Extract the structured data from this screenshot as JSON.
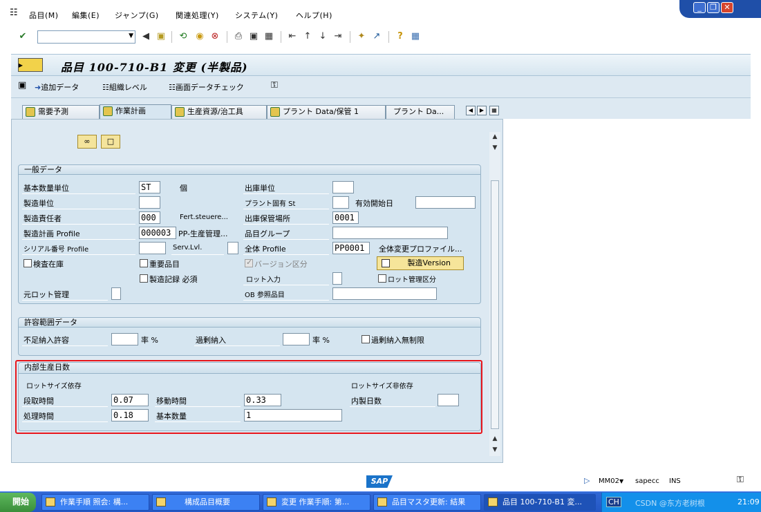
{
  "menu": [
    "品目(M)",
    "編集(E)",
    "ジャンプ(G)",
    "関連処理(Y)",
    "システム(Y)",
    "ヘルプ(H)"
  ],
  "title": "品目 100-710-B1 変更 (半製品)",
  "app_toolbar": {
    "add_data": "追加データ",
    "org_levels": "組織レベル",
    "check_data": "画面データチェック"
  },
  "tabs": [
    "需要予測",
    "作業計画",
    "生産資源/治工具",
    "プラント Data/保管 1",
    "プラント Da..."
  ],
  "active_tab": "作業計画",
  "general": {
    "title": "一般データ",
    "base_uom_label": "基本数量単位",
    "base_uom_value": "ST",
    "base_uom_text": "個",
    "issue_unit_label": "出庫単位",
    "issue_unit_value": "",
    "prod_unit_label": "製造単位",
    "prod_unit_value": "",
    "plant_status_label": "プラント固有 St",
    "plant_status_value": "",
    "valid_from_label": "有効開始日",
    "valid_from_value": "",
    "prod_sup_label": "製造責任者",
    "prod_sup_value": "000",
    "fert_label": "Fert.steuere...",
    "storage_loc_label": "出庫保管場所",
    "storage_loc_value": "0001",
    "prod_profile_label": "製造計画 Profile",
    "prod_profile_value": "000003",
    "prod_profile_text": "PP-生産管理...",
    "mat_group_label": "品目グループ",
    "mat_group_value": "",
    "serial_label": "シリアル番号 Profile",
    "serial_value": "",
    "serv_lvl_label": "Serv.Lvl.",
    "serv_lvl_value": "",
    "overall_profile_label": "全体 Profile",
    "overall_profile_value": "PP0001",
    "overall_change_label": "全体変更プロファイル...",
    "inspection_stock_label": "検査在庫",
    "critical_part_label": "重要品目",
    "version_ind_label": "バージョン区分",
    "mfg_version_button": "製造Version",
    "doc_required_label": "製造記録 必須",
    "batch_entry_label": "ロット入力",
    "batch_entry_value": "",
    "batch_mgmt_label": "ロット管理区分",
    "orig_batch_label": "元ロット管理",
    "ob_ref_label": "OB 参照品目",
    "ob_ref_value": ""
  },
  "tolerance": {
    "title": "許容範囲データ",
    "under_label": "不足納入許容",
    "under_value": "",
    "under_unit": "率 %",
    "over_label": "過剰納入",
    "over_value": "",
    "over_unit": "率 %",
    "unlimited_label": "過剰納入無制限"
  },
  "inhouse": {
    "title": "内部生産日数",
    "lot_dep_label": "ロットサイズ依存",
    "lot_indep_label": "ロットサイズ非依存",
    "setup_label": "段取時間",
    "setup_value": "0.07",
    "interop_label": "移動時間",
    "interop_value": "0.33",
    "inhouse_days_label": "内製日数",
    "inhouse_days_value": "",
    "processing_label": "処理時間",
    "processing_value": "0.18",
    "base_qty_label": "基本数量",
    "base_qty_value": "1"
  },
  "status": {
    "logo": "SAP",
    "tcode": "MM02",
    "server": "sapecc",
    "mode": "INS"
  },
  "taskbar": {
    "start": "開始",
    "tasks": [
      "作業手順 照会: 構...",
      "構成品目概要",
      "変更 作業手順: 第...",
      "品目マスタ更新: 結果",
      "品目 100-710-B1 変..."
    ],
    "lang": "CH",
    "watermark": "CSDN @东方老树根",
    "time": "21:09"
  }
}
